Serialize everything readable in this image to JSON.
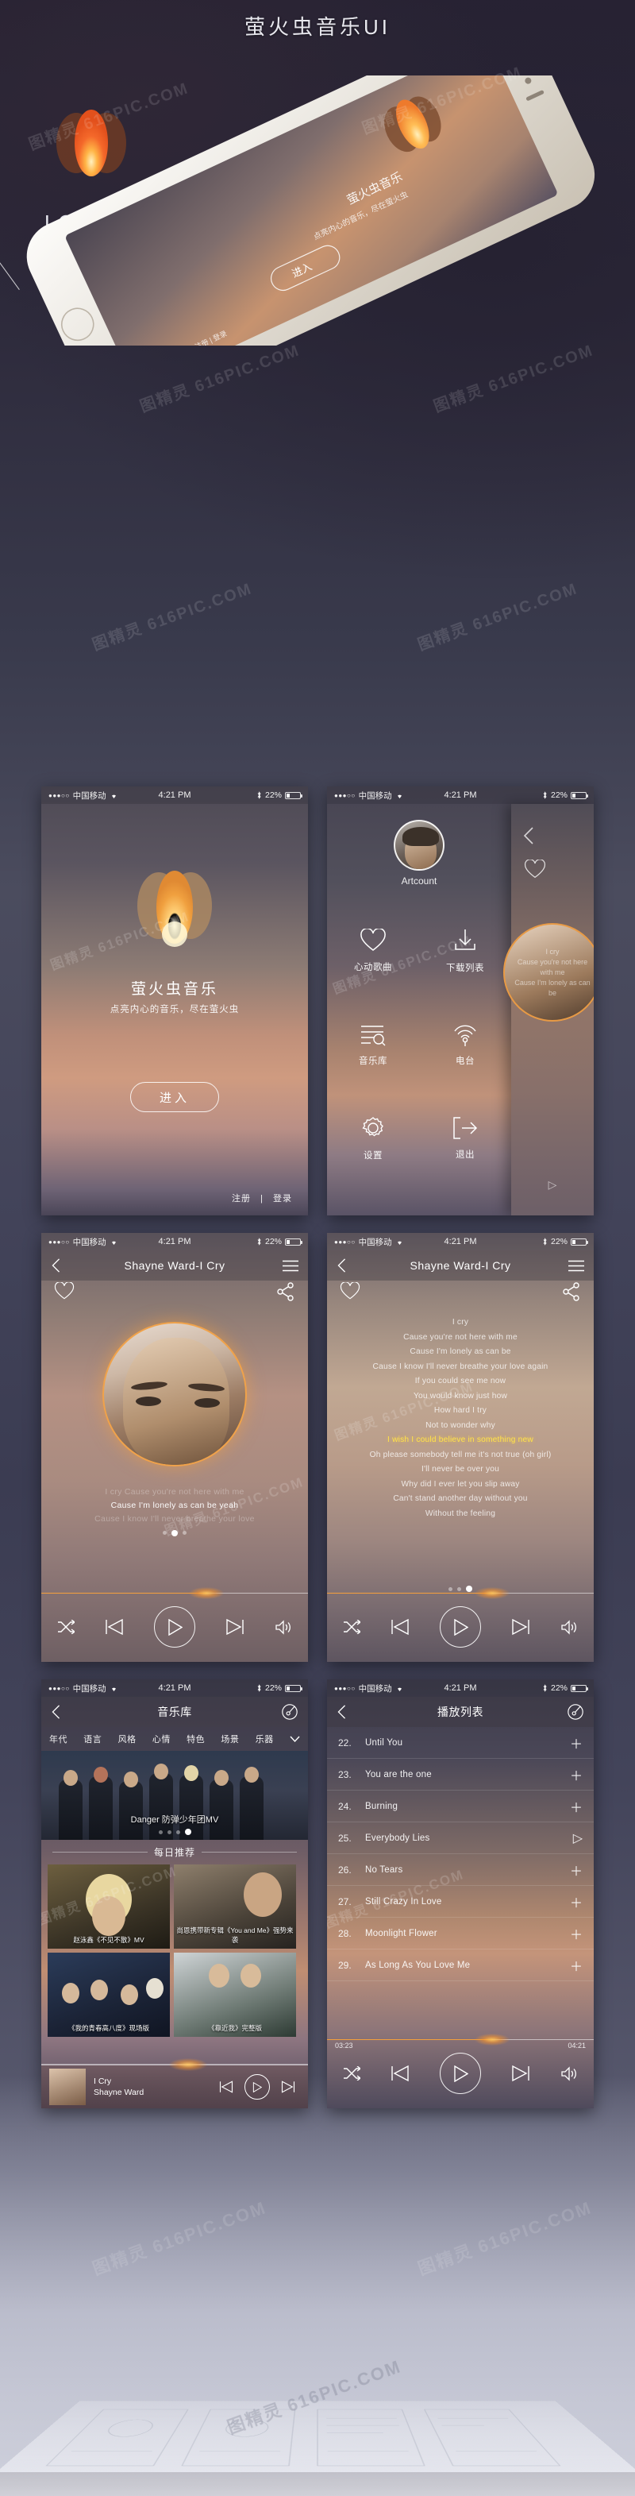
{
  "header": {
    "title": "萤火虫音乐UI",
    "logo_label": "LOGO",
    "logo_icon": "firefly-flame-logo"
  },
  "watermark": {
    "text": "图精灵 616PIC.COM"
  },
  "statusbar": {
    "signal_dots": "●●●○○",
    "carrier": "中国移动",
    "wifi_icon": "wifi-icon",
    "time": "4:21 PM",
    "bluetooth_icon": "bluetooth-icon",
    "battery_pct": "22%"
  },
  "hero_phone": {
    "app_name": "萤火虫音乐",
    "tagline": "点亮内心的音乐，尽在萤火虫",
    "enter_label": "进入",
    "register_label": "注册",
    "divider": "|",
    "login_label": "登录"
  },
  "screen_splash": {
    "app_name": "萤火虫音乐",
    "tagline": "点亮内心的音乐，尽在萤火虫",
    "enter_label": "进入",
    "register_label": "注册",
    "divider": "|",
    "login_label": "登录"
  },
  "screen_menu": {
    "username": "Artcount",
    "avatar_icon": "user-avatar",
    "items": [
      {
        "label": "心动歌曲",
        "icon": "heart-icon"
      },
      {
        "label": "下载列表",
        "icon": "download-icon"
      },
      {
        "label": "音乐库",
        "icon": "library-search-icon"
      },
      {
        "label": "电台",
        "icon": "radio-icon"
      },
      {
        "label": "设置",
        "icon": "gear-icon"
      },
      {
        "label": "退出",
        "icon": "logout-icon"
      }
    ],
    "peek_lines": [
      "I cry",
      "Cause you're not here with me",
      "Cause I'm lonely as can be"
    ]
  },
  "screen_player": {
    "nav_title": "Shayne Ward-I Cry",
    "back_icon": "back-chevron-icon",
    "menu_icon": "hamburger-icon",
    "favorite_icon": "heart-icon",
    "share_icon": "share-icon",
    "lyrics_preview": [
      "I cry Cause you're not here with me",
      "Cause I'm lonely as can be yeah",
      "Cause I know I'll never breathe your love"
    ],
    "current_lyric_index": 1,
    "page_dots": 3,
    "active_dot": 1,
    "controls": {
      "shuffle_icon": "shuffle-icon",
      "prev_icon": "previous-track-icon",
      "play_icon": "play-icon",
      "next_icon": "next-track-icon",
      "volume_icon": "volume-icon"
    }
  },
  "screen_lyrics": {
    "nav_title": "Shayne Ward-I Cry",
    "lines": [
      "I cry",
      "Cause you're not here with me",
      "Cause I'm lonely as can be",
      "Cause I know I'll never breathe your love again",
      "If you could see me now",
      "You would know just how",
      "How hard I try",
      "Not to wonder why",
      "I wish I could believe in something new",
      "Oh please somebody tell me it's not true (oh girl)",
      "I'll never be over you",
      "Why did I ever let you slip away",
      "Can't stand another day without you",
      "Without the feeling"
    ],
    "highlight_index": 8,
    "page_dots": 3,
    "active_dot": 2
  },
  "screen_library": {
    "nav_title": "音乐库",
    "back_icon": "back-chevron-icon",
    "disc_icon": "vinyl-disc-icon",
    "filters": [
      "年代",
      "语言",
      "风格",
      "心情",
      "特色",
      "场景",
      "乐器"
    ],
    "filter_more_icon": "chevron-down-icon",
    "banner_caption": "Danger 防弹少年团MV",
    "banner_dots": 4,
    "banner_active_dot": 3,
    "section_title": "每日推荐",
    "cards": [
      "赵泳鑫《不见不散》MV",
      "尚恩携带新专辑《You and Me》强势来袭",
      "《我的青春高八度》现场版",
      "《靠近我》完整版"
    ],
    "mini_player": {
      "title": "I Cry",
      "artist": "Shayne Ward",
      "prev_icon": "previous-track-icon",
      "play_icon": "play-icon",
      "next_icon": "next-track-icon"
    }
  },
  "screen_playlist": {
    "nav_title": "播放列表",
    "back_icon": "back-chevron-icon",
    "disc_icon": "vinyl-disc-icon",
    "tracks": [
      {
        "num": "22.",
        "name": "Until You",
        "action": "add"
      },
      {
        "num": "23.",
        "name": "You are the one",
        "action": "add"
      },
      {
        "num": "24.",
        "name": "Burning",
        "action": "add"
      },
      {
        "num": "25.",
        "name": "Everybody Lies",
        "action": "play"
      },
      {
        "num": "26.",
        "name": "No Tears",
        "action": "add"
      },
      {
        "num": "27.",
        "name": "Still Crazy In Love",
        "action": "add"
      },
      {
        "num": "28.",
        "name": "Moonlight Flower",
        "action": "add"
      },
      {
        "num": "29.",
        "name": "As Long As You Love Me",
        "action": "add"
      }
    ],
    "time_elapsed": "03:23",
    "time_total": "04:21",
    "controls": {
      "shuffle_icon": "shuffle-icon",
      "prev_icon": "previous-track-icon",
      "play_icon": "play-icon",
      "next_icon": "next-track-icon",
      "volume_icon": "volume-icon"
    }
  },
  "colors": {
    "accent": "#f5a03c",
    "highlight_lyric": "#ffe24a",
    "page_bg": "#3b3c52"
  }
}
